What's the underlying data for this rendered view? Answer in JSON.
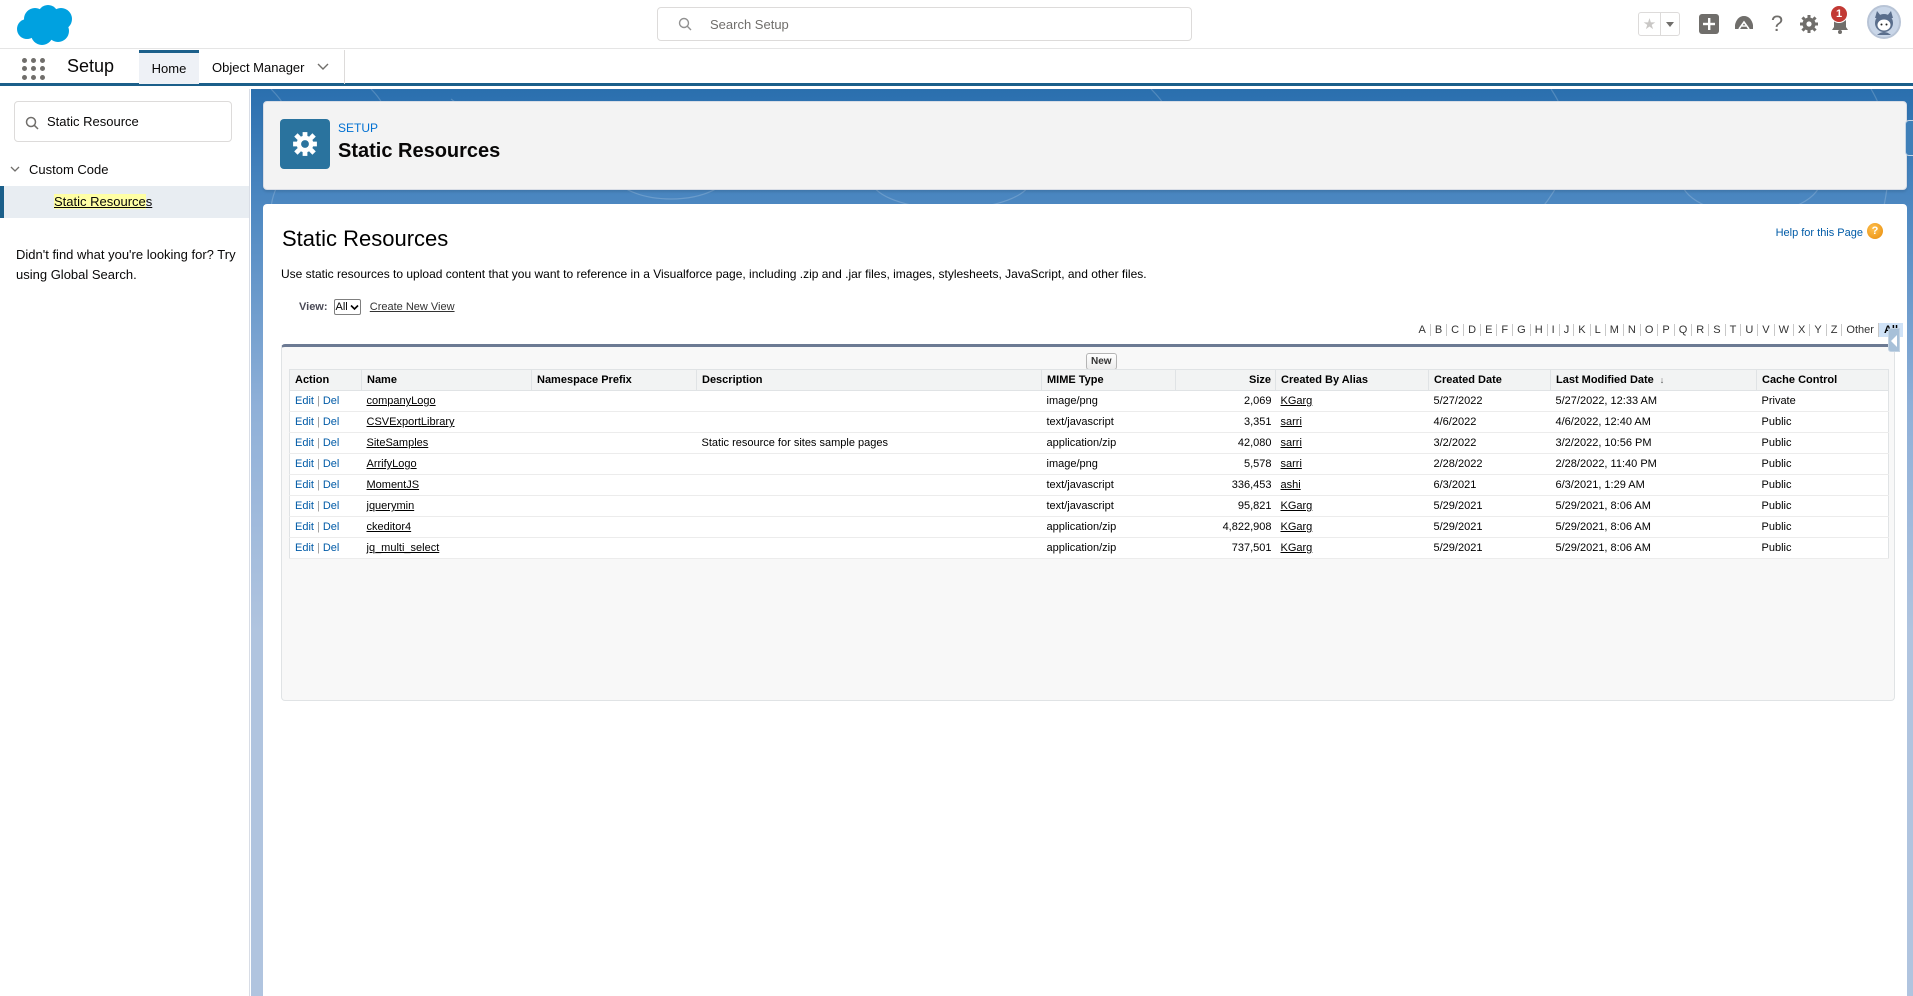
{
  "global_header": {
    "search_placeholder": "Search Setup",
    "notification_count": "1",
    "icons": [
      "salesforce-logo",
      "search-icon",
      "favorites-star-icon",
      "favorites-dropdown-icon",
      "global-actions-add-icon",
      "trailhead-icon",
      "help-icon",
      "setup-gear-icon",
      "notifications-bell-icon",
      "user-avatar"
    ]
  },
  "context_bar": {
    "app_name": "Setup",
    "tabs": [
      {
        "label": "Home",
        "active": true
      },
      {
        "label": "Object Manager",
        "has_dropdown": true
      }
    ]
  },
  "sidebar": {
    "quick_find_value": "Static Resource",
    "tree": {
      "section_label": "Custom Code",
      "items": [
        {
          "label_highlight": "Static Resource",
          "label_rest": "s",
          "selected": true
        }
      ]
    },
    "not_found_text": "Didn't find what you're looking for? Try using Global Search."
  },
  "page_header": {
    "eyebrow": "SETUP",
    "title": "Static Resources"
  },
  "content": {
    "title": "Static Resources",
    "help_link": "Help for this Page",
    "help_icon_glyph": "?",
    "description": "Use static resources to upload content that you want to reference in a Visualforce page, including .zip and .jar files, images, stylesheets, JavaScript, and other files.",
    "view_label": "View:",
    "view_selected": "All",
    "create_new_view": "Create New View",
    "alpha_filter": [
      "A",
      "B",
      "C",
      "D",
      "E",
      "F",
      "G",
      "H",
      "I",
      "J",
      "K",
      "L",
      "M",
      "N",
      "O",
      "P",
      "Q",
      "R",
      "S",
      "T",
      "U",
      "V",
      "W",
      "X",
      "Y",
      "Z",
      "Other",
      "All"
    ],
    "alpha_active": "All",
    "new_button": "New"
  },
  "table": {
    "columns": [
      "Action",
      "Name",
      "Namespace Prefix",
      "Description",
      "MIME Type",
      "Size",
      "Created By Alias",
      "Created Date",
      "Last Modified Date",
      "Cache Control"
    ],
    "sorted_column": "Last Modified Date",
    "sort_direction": "desc",
    "action_edit": "Edit",
    "action_del": "Del",
    "rows": [
      {
        "name": "companyLogo",
        "namespace": "",
        "description": "",
        "mime": "image/png",
        "size": "2,069",
        "created_by": "KGarg",
        "created_date": "5/27/2022",
        "last_modified": "5/27/2022, 12:33 AM",
        "cache": "Private"
      },
      {
        "name": "CSVExportLibrary",
        "namespace": "",
        "description": "",
        "mime": "text/javascript",
        "size": "3,351",
        "created_by": "sarri",
        "created_date": "4/6/2022",
        "last_modified": "4/6/2022, 12:40 AM",
        "cache": "Public"
      },
      {
        "name": "SiteSamples",
        "namespace": "",
        "description": "Static resource for sites sample pages",
        "mime": "application/zip",
        "size": "42,080",
        "created_by": "sarri",
        "created_date": "3/2/2022",
        "last_modified": "3/2/2022, 10:56 PM",
        "cache": "Public"
      },
      {
        "name": "ArrifyLogo",
        "namespace": "",
        "description": "",
        "mime": "image/png",
        "size": "5,578",
        "created_by": "sarri",
        "created_date": "2/28/2022",
        "last_modified": "2/28/2022, 11:40 PM",
        "cache": "Public"
      },
      {
        "name": "MomentJS",
        "namespace": "",
        "description": "",
        "mime": "text/javascript",
        "size": "336,453",
        "created_by": "ashi",
        "created_date": "6/3/2021",
        "last_modified": "6/3/2021, 1:29 AM",
        "cache": "Public"
      },
      {
        "name": "jquerymin",
        "namespace": "",
        "description": "",
        "mime": "text/javascript",
        "size": "95,821",
        "created_by": "KGarg",
        "created_date": "5/29/2021",
        "last_modified": "5/29/2021, 8:06 AM",
        "cache": "Public"
      },
      {
        "name": "ckeditor4",
        "namespace": "",
        "description": "",
        "mime": "application/zip",
        "size": "4,822,908",
        "created_by": "KGarg",
        "created_date": "5/29/2021",
        "last_modified": "5/29/2021, 8:06 AM",
        "cache": "Public"
      },
      {
        "name": "jq_multi_select",
        "namespace": "",
        "description": "",
        "mime": "application/zip",
        "size": "737,501",
        "created_by": "KGarg",
        "created_date": "5/29/2021",
        "last_modified": "5/29/2021, 8:06 AM",
        "cache": "Public"
      }
    ]
  },
  "colors": {
    "brand_blue": "#00a1e0",
    "nav_accent": "#1b5f8a",
    "setup_icon_bg": "#2a739e",
    "link_blue": "#015ba7",
    "notification_red": "#c23934",
    "highlight_yellow": "#ffffa5",
    "help_orange": "#f39c12"
  }
}
